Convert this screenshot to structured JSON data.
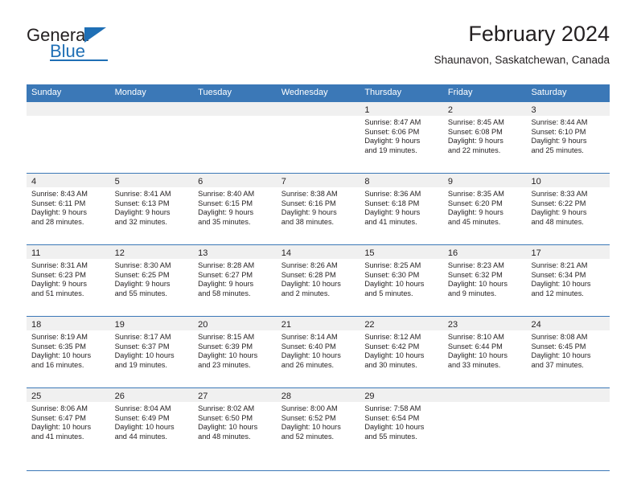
{
  "brand": {
    "name_part1": "General",
    "name_part2": "Blue",
    "logo_icon": "triangle-icon",
    "accent_color": "#1f6fb5"
  },
  "header": {
    "title": "February 2024",
    "location": "Shaunavon, Saskatchewan, Canada"
  },
  "theme": {
    "header_blue": "#3b78b7",
    "day_strip_gray": "#f0f0f0",
    "text_color": "#231f20"
  },
  "weekdays": [
    "Sunday",
    "Monday",
    "Tuesday",
    "Wednesday",
    "Thursday",
    "Friday",
    "Saturday"
  ],
  "weeks": [
    [
      {
        "day": "",
        "sunrise": "",
        "sunset": "",
        "daylight_line1": "",
        "daylight_line2": ""
      },
      {
        "day": "",
        "sunrise": "",
        "sunset": "",
        "daylight_line1": "",
        "daylight_line2": ""
      },
      {
        "day": "",
        "sunrise": "",
        "sunset": "",
        "daylight_line1": "",
        "daylight_line2": ""
      },
      {
        "day": "",
        "sunrise": "",
        "sunset": "",
        "daylight_line1": "",
        "daylight_line2": ""
      },
      {
        "day": "1",
        "sunrise": "Sunrise: 8:47 AM",
        "sunset": "Sunset: 6:06 PM",
        "daylight_line1": "Daylight: 9 hours",
        "daylight_line2": "and 19 minutes."
      },
      {
        "day": "2",
        "sunrise": "Sunrise: 8:45 AM",
        "sunset": "Sunset: 6:08 PM",
        "daylight_line1": "Daylight: 9 hours",
        "daylight_line2": "and 22 minutes."
      },
      {
        "day": "3",
        "sunrise": "Sunrise: 8:44 AM",
        "sunset": "Sunset: 6:10 PM",
        "daylight_line1": "Daylight: 9 hours",
        "daylight_line2": "and 25 minutes."
      }
    ],
    [
      {
        "day": "4",
        "sunrise": "Sunrise: 8:43 AM",
        "sunset": "Sunset: 6:11 PM",
        "daylight_line1": "Daylight: 9 hours",
        "daylight_line2": "and 28 minutes."
      },
      {
        "day": "5",
        "sunrise": "Sunrise: 8:41 AM",
        "sunset": "Sunset: 6:13 PM",
        "daylight_line1": "Daylight: 9 hours",
        "daylight_line2": "and 32 minutes."
      },
      {
        "day": "6",
        "sunrise": "Sunrise: 8:40 AM",
        "sunset": "Sunset: 6:15 PM",
        "daylight_line1": "Daylight: 9 hours",
        "daylight_line2": "and 35 minutes."
      },
      {
        "day": "7",
        "sunrise": "Sunrise: 8:38 AM",
        "sunset": "Sunset: 6:16 PM",
        "daylight_line1": "Daylight: 9 hours",
        "daylight_line2": "and 38 minutes."
      },
      {
        "day": "8",
        "sunrise": "Sunrise: 8:36 AM",
        "sunset": "Sunset: 6:18 PM",
        "daylight_line1": "Daylight: 9 hours",
        "daylight_line2": "and 41 minutes."
      },
      {
        "day": "9",
        "sunrise": "Sunrise: 8:35 AM",
        "sunset": "Sunset: 6:20 PM",
        "daylight_line1": "Daylight: 9 hours",
        "daylight_line2": "and 45 minutes."
      },
      {
        "day": "10",
        "sunrise": "Sunrise: 8:33 AM",
        "sunset": "Sunset: 6:22 PM",
        "daylight_line1": "Daylight: 9 hours",
        "daylight_line2": "and 48 minutes."
      }
    ],
    [
      {
        "day": "11",
        "sunrise": "Sunrise: 8:31 AM",
        "sunset": "Sunset: 6:23 PM",
        "daylight_line1": "Daylight: 9 hours",
        "daylight_line2": "and 51 minutes."
      },
      {
        "day": "12",
        "sunrise": "Sunrise: 8:30 AM",
        "sunset": "Sunset: 6:25 PM",
        "daylight_line1": "Daylight: 9 hours",
        "daylight_line2": "and 55 minutes."
      },
      {
        "day": "13",
        "sunrise": "Sunrise: 8:28 AM",
        "sunset": "Sunset: 6:27 PM",
        "daylight_line1": "Daylight: 9 hours",
        "daylight_line2": "and 58 minutes."
      },
      {
        "day": "14",
        "sunrise": "Sunrise: 8:26 AM",
        "sunset": "Sunset: 6:28 PM",
        "daylight_line1": "Daylight: 10 hours",
        "daylight_line2": "and 2 minutes."
      },
      {
        "day": "15",
        "sunrise": "Sunrise: 8:25 AM",
        "sunset": "Sunset: 6:30 PM",
        "daylight_line1": "Daylight: 10 hours",
        "daylight_line2": "and 5 minutes."
      },
      {
        "day": "16",
        "sunrise": "Sunrise: 8:23 AM",
        "sunset": "Sunset: 6:32 PM",
        "daylight_line1": "Daylight: 10 hours",
        "daylight_line2": "and 9 minutes."
      },
      {
        "day": "17",
        "sunrise": "Sunrise: 8:21 AM",
        "sunset": "Sunset: 6:34 PM",
        "daylight_line1": "Daylight: 10 hours",
        "daylight_line2": "and 12 minutes."
      }
    ],
    [
      {
        "day": "18",
        "sunrise": "Sunrise: 8:19 AM",
        "sunset": "Sunset: 6:35 PM",
        "daylight_line1": "Daylight: 10 hours",
        "daylight_line2": "and 16 minutes."
      },
      {
        "day": "19",
        "sunrise": "Sunrise: 8:17 AM",
        "sunset": "Sunset: 6:37 PM",
        "daylight_line1": "Daylight: 10 hours",
        "daylight_line2": "and 19 minutes."
      },
      {
        "day": "20",
        "sunrise": "Sunrise: 8:15 AM",
        "sunset": "Sunset: 6:39 PM",
        "daylight_line1": "Daylight: 10 hours",
        "daylight_line2": "and 23 minutes."
      },
      {
        "day": "21",
        "sunrise": "Sunrise: 8:14 AM",
        "sunset": "Sunset: 6:40 PM",
        "daylight_line1": "Daylight: 10 hours",
        "daylight_line2": "and 26 minutes."
      },
      {
        "day": "22",
        "sunrise": "Sunrise: 8:12 AM",
        "sunset": "Sunset: 6:42 PM",
        "daylight_line1": "Daylight: 10 hours",
        "daylight_line2": "and 30 minutes."
      },
      {
        "day": "23",
        "sunrise": "Sunrise: 8:10 AM",
        "sunset": "Sunset: 6:44 PM",
        "daylight_line1": "Daylight: 10 hours",
        "daylight_line2": "and 33 minutes."
      },
      {
        "day": "24",
        "sunrise": "Sunrise: 8:08 AM",
        "sunset": "Sunset: 6:45 PM",
        "daylight_line1": "Daylight: 10 hours",
        "daylight_line2": "and 37 minutes."
      }
    ],
    [
      {
        "day": "25",
        "sunrise": "Sunrise: 8:06 AM",
        "sunset": "Sunset: 6:47 PM",
        "daylight_line1": "Daylight: 10 hours",
        "daylight_line2": "and 41 minutes."
      },
      {
        "day": "26",
        "sunrise": "Sunrise: 8:04 AM",
        "sunset": "Sunset: 6:49 PM",
        "daylight_line1": "Daylight: 10 hours",
        "daylight_line2": "and 44 minutes."
      },
      {
        "day": "27",
        "sunrise": "Sunrise: 8:02 AM",
        "sunset": "Sunset: 6:50 PM",
        "daylight_line1": "Daylight: 10 hours",
        "daylight_line2": "and 48 minutes."
      },
      {
        "day": "28",
        "sunrise": "Sunrise: 8:00 AM",
        "sunset": "Sunset: 6:52 PM",
        "daylight_line1": "Daylight: 10 hours",
        "daylight_line2": "and 52 minutes."
      },
      {
        "day": "29",
        "sunrise": "Sunrise: 7:58 AM",
        "sunset": "Sunset: 6:54 PM",
        "daylight_line1": "Daylight: 10 hours",
        "daylight_line2": "and 55 minutes."
      },
      {
        "day": "",
        "sunrise": "",
        "sunset": "",
        "daylight_line1": "",
        "daylight_line2": ""
      },
      {
        "day": "",
        "sunrise": "",
        "sunset": "",
        "daylight_line1": "",
        "daylight_line2": ""
      }
    ]
  ]
}
